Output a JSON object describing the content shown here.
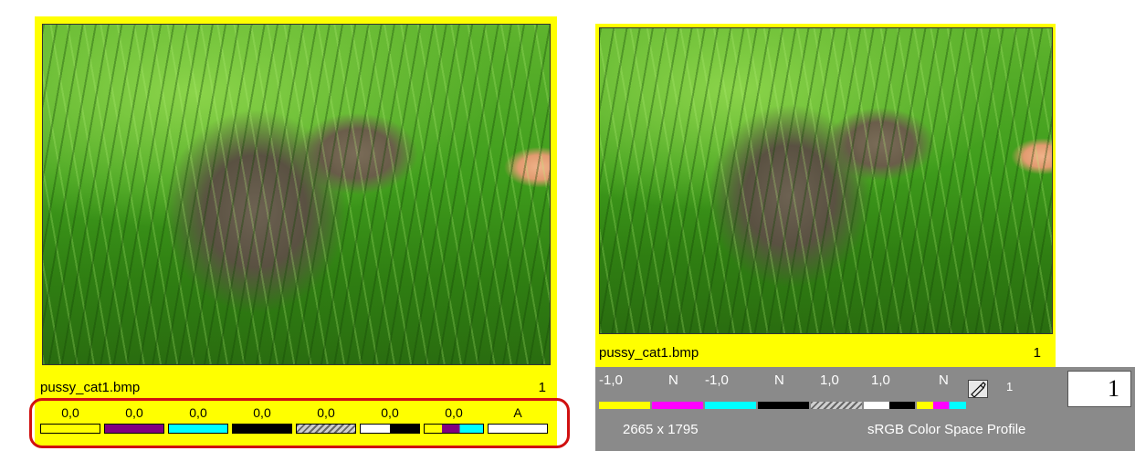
{
  "left_card": {
    "filename": "pussy_cat1.bmp",
    "page_number": "1",
    "values": [
      "0,0",
      "0,0",
      "0,0",
      "0,0",
      "0,0",
      "0,0",
      "0,0",
      "A"
    ],
    "swatches": [
      {
        "name": "yellow",
        "color": "#ffff00"
      },
      {
        "name": "magenta",
        "color": "#800080"
      },
      {
        "name": "cyan",
        "color": "#00ffff"
      },
      {
        "name": "black",
        "color": "#000000"
      },
      {
        "name": "hatched",
        "color": "hatched"
      },
      {
        "name": "white-black",
        "color": "#ffffff"
      },
      {
        "name": "mini-cmy",
        "color": "mixed"
      },
      {
        "name": "white",
        "color": "#ffffff"
      }
    ]
  },
  "right_card": {
    "filename": "pussy_cat1.bmp",
    "page_number": "1"
  },
  "panel": {
    "values": [
      "-1,0",
      "N",
      "-1,0",
      "N",
      "1,0",
      "1,0",
      "N"
    ],
    "tool_count": "1",
    "dimensions": "2665 x 1795",
    "profile": "sRGB Color Space Profile",
    "page_box": "1"
  },
  "colors": {
    "card_yellow": "#ffff00",
    "highlight_red": "#d01010",
    "panel_gray": "#8a8a8a"
  }
}
